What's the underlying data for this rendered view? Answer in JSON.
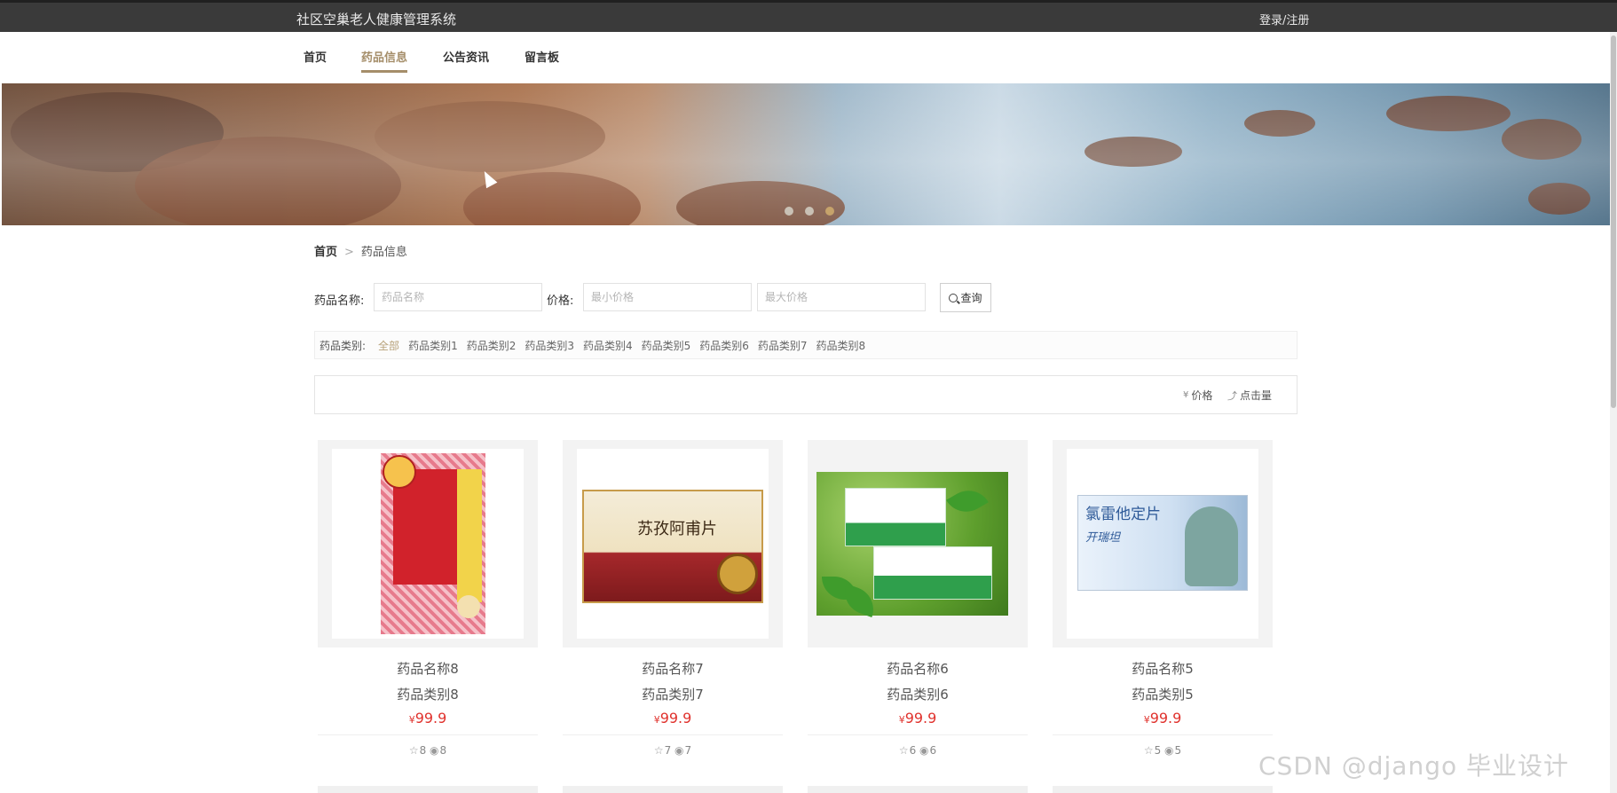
{
  "header": {
    "title": "社区空巢老人健康管理系统",
    "login": "登录/注册"
  },
  "nav": [
    {
      "label": "首页"
    },
    {
      "label": "药品信息"
    },
    {
      "label": "公告资讯"
    },
    {
      "label": "留言板"
    }
  ],
  "nav_active_index": 1,
  "banner": {
    "slides": 3,
    "active_slide": 3
  },
  "breadcrumb": {
    "home": "首页",
    "current": "药品信息"
  },
  "search": {
    "name_label": "药品名称:",
    "name_placeholder": "药品名称",
    "price_label": "价格:",
    "min_placeholder": "最小价格",
    "max_placeholder": "最大价格",
    "button": "查询"
  },
  "categories": {
    "label": "药品类别:",
    "items": [
      "全部",
      "药品类别1",
      "药品类别2",
      "药品类别3",
      "药品类别4",
      "药品类别5",
      "药品类别6",
      "药品类别7",
      "药品类别8"
    ],
    "active_index": 0
  },
  "sort": {
    "price": "价格",
    "clicks": "点击量"
  },
  "products": [
    {
      "name": "药品名称8",
      "category": "药品类别8",
      "price": "99.9",
      "likes": "8",
      "views": "8",
      "art": "box-red"
    },
    {
      "name": "药品名称7",
      "category": "药品类别7",
      "price": "99.9",
      "likes": "7",
      "views": "7",
      "art": "box-gold"
    },
    {
      "name": "药品名称6",
      "category": "药品类别6",
      "price": "99.9",
      "likes": "6",
      "views": "6",
      "art": "green"
    },
    {
      "name": "药品名称5",
      "category": "药品类别5",
      "price": "99.9",
      "likes": "5",
      "views": "5",
      "art": "box-blue"
    }
  ],
  "currency_symbol": "¥",
  "watermark": "CSDN @django 毕业设计",
  "colors": {
    "accent": "#a58e6a",
    "price": "#e0322d",
    "topbar": "#3a3a3a"
  }
}
